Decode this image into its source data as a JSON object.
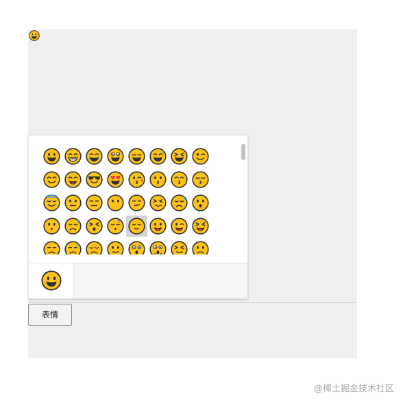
{
  "editor": {
    "inserted_emoji": "grinning-face-icon"
  },
  "emoji_picker": {
    "emojis": [
      "grinning-face",
      "beaming-face",
      "tears-of-joy",
      "smiling-big-eyes",
      "grinning-squinting-eyes",
      "grinning-sweat",
      "squinting-laughing",
      "winking-face",
      "smiling-eyes",
      "face-savoring-food",
      "sunglasses-face",
      "heart-eyes",
      "face-blowing-kiss",
      "kissing-face",
      "kissing-smiling-eyes",
      "kissing-closed-eyes",
      "smiling-halo",
      "neutral-face",
      "expressionless-face",
      "face-without-mouth",
      "smirking-face",
      "persevering-face",
      "disappointed-relieved",
      "face-open-mouth",
      "hushed-face",
      "sad-but-relieved",
      "tired-face",
      "sleeping-face",
      "relieved-face",
      "face-with-tongue",
      "winking-tongue",
      "squinting-tongue",
      "unamused-face",
      "downcast-sweat",
      "pensive-face",
      "confused-face",
      "astonished-face",
      "persevering-hands",
      "confounded-face",
      "worried-face"
    ],
    "hovered_emoji": "relieved-face",
    "category_tab_icon": "grinning-face-icon"
  },
  "toolbar": {
    "emoji_button_label": "表情"
  },
  "watermark": "@稀土掘金技术社区",
  "colors": {
    "emoji_yellow": "#fcc21b",
    "emoji_outline": "#2f2f2f",
    "hover_background": "#d4d4d4",
    "editor_background": "#efefef"
  }
}
